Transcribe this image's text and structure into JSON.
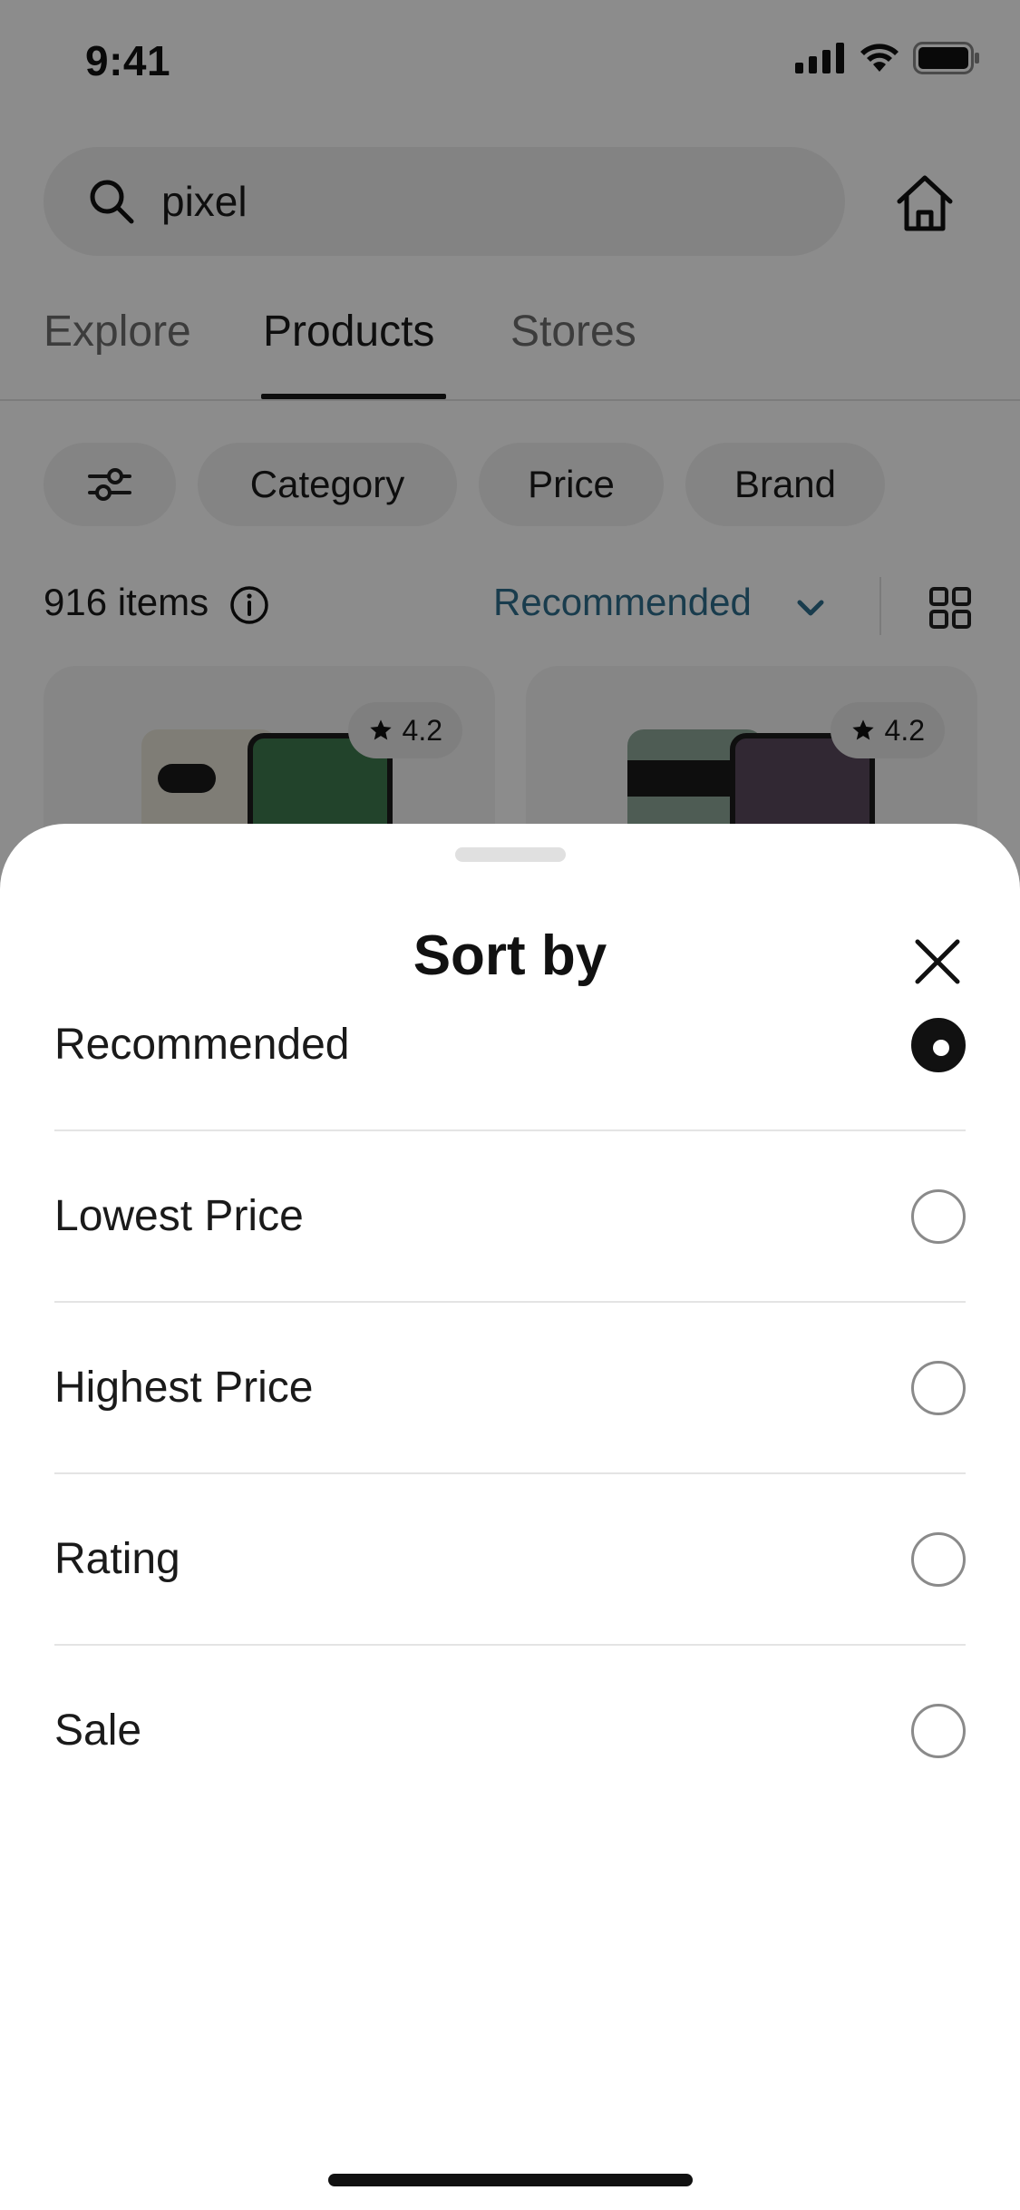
{
  "status_bar": {
    "time": "9:41"
  },
  "search": {
    "query": "pixel"
  },
  "tabs": [
    {
      "label": "Explore"
    },
    {
      "label": "Products",
      "active": true
    },
    {
      "label": "Stores"
    }
  ],
  "filters": {
    "chips": [
      "Category",
      "Price",
      "Brand"
    ]
  },
  "results": {
    "count": "916 items",
    "sort_label": "Recommended"
  },
  "products": [
    {
      "rating": "4.2"
    },
    {
      "rating": "4.2"
    }
  ],
  "sort_sheet": {
    "title": "Sort by",
    "options": [
      {
        "label": "Recommended",
        "selected": true
      },
      {
        "label": "Lowest Price",
        "selected": false
      },
      {
        "label": "Highest Price",
        "selected": false
      },
      {
        "label": "Rating",
        "selected": false
      },
      {
        "label": "Sale",
        "selected": false
      }
    ]
  },
  "colors": {
    "accent": "#2e6e8c",
    "overlay": "rgba(0,0,0,0.45)",
    "text": "#1a1a1a"
  },
  "icons": [
    "signal-icon",
    "wifi-icon",
    "battery-icon",
    "search-icon",
    "home-icon",
    "filter-sliders-icon",
    "info-icon",
    "chevron-down-icon",
    "grid-icon",
    "star-icon",
    "close-icon"
  ]
}
